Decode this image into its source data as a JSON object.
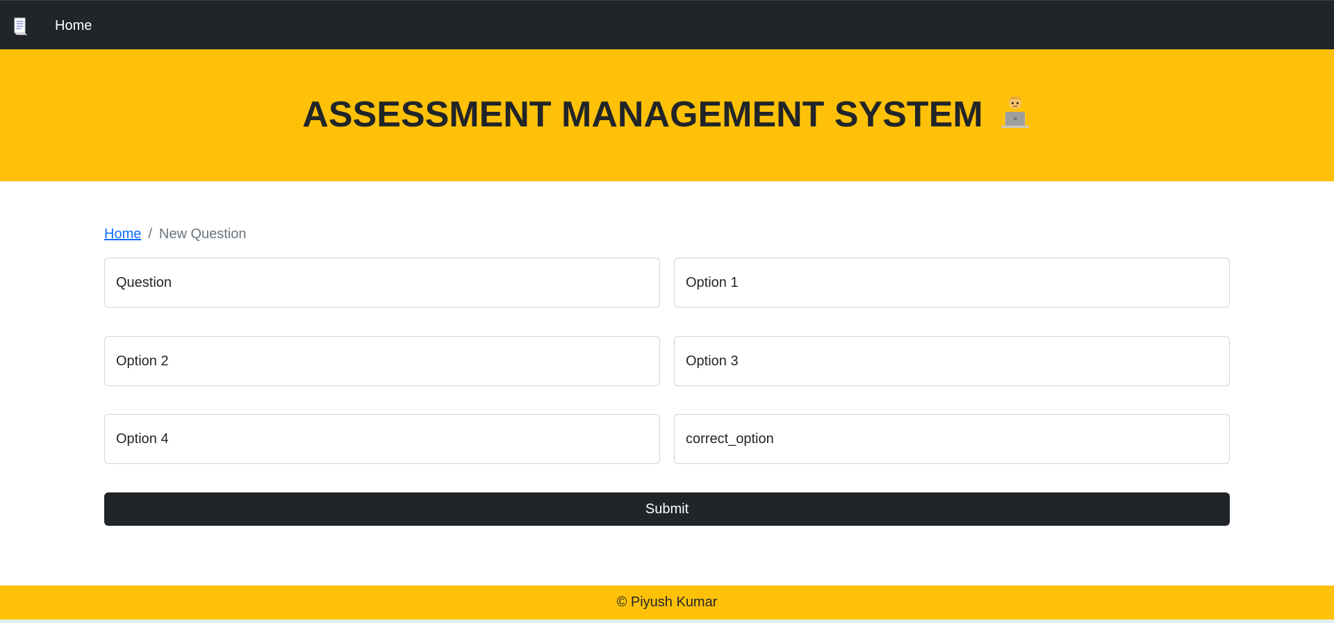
{
  "navbar": {
    "brand_icon": "scroll-icon",
    "home_label": "Home"
  },
  "hero": {
    "title": "ASSESSMENT MANAGEMENT SYSTEM",
    "emoji_icon": "technologist-laptop-icon"
  },
  "breadcrumb": {
    "home_label": "Home",
    "separator": "/",
    "current": "New Question"
  },
  "form": {
    "question_placeholder": "Question",
    "option1_placeholder": "Option 1",
    "option2_placeholder": "Option 2",
    "option3_placeholder": "Option 3",
    "option4_placeholder": "Option 4",
    "correct_option_placeholder": "correct_option",
    "submit_label": "Submit"
  },
  "footer": {
    "text": "© Piyush Kumar"
  },
  "colors": {
    "navbar": "#212529",
    "accent": "#ffc107",
    "link": "#0d6efd",
    "button": "#212529"
  }
}
